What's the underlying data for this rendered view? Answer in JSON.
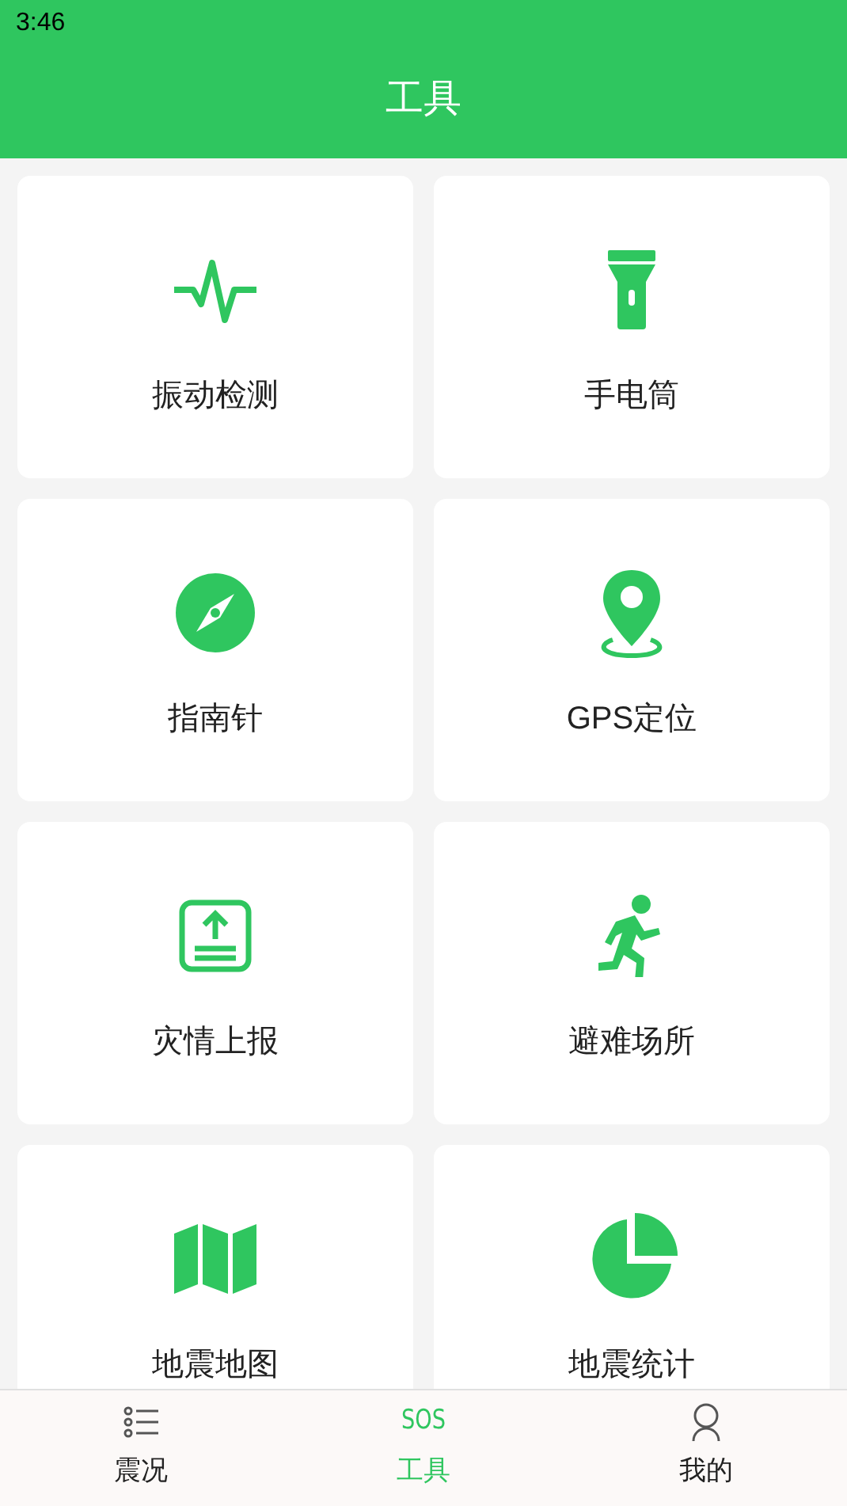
{
  "status_bar": {
    "time": "3:46"
  },
  "header": {
    "title": "工具"
  },
  "tools": [
    {
      "kind": "pulse",
      "label": "振动检测"
    },
    {
      "kind": "flashlight",
      "label": "手电筒"
    },
    {
      "kind": "compass",
      "label": "指南针"
    },
    {
      "kind": "pin",
      "label": "GPS定位"
    },
    {
      "kind": "upload",
      "label": "灾情上报"
    },
    {
      "kind": "runner",
      "label": "避难场所"
    },
    {
      "kind": "map",
      "label": "地震地图"
    },
    {
      "kind": "pie",
      "label": "地震统计"
    }
  ],
  "tab_bar": [
    {
      "kind": "list",
      "label": "震况",
      "selected": false
    },
    {
      "kind": "sos",
      "icon_text": "SOS",
      "label": "工具",
      "selected": true
    },
    {
      "kind": "person",
      "label": "我的",
      "selected": false
    }
  ]
}
